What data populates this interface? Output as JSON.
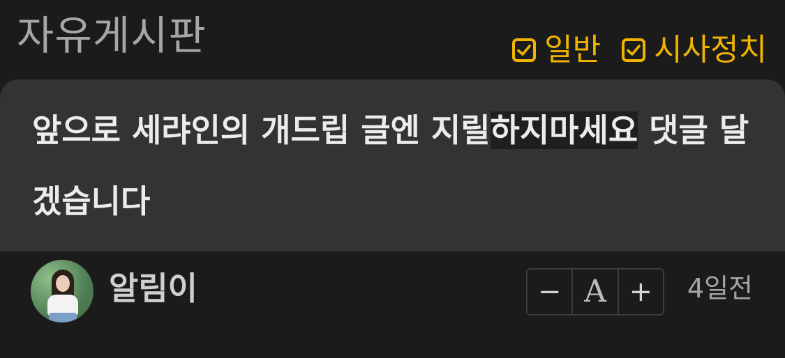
{
  "header": {
    "board_title": "자유게시판",
    "filters": [
      {
        "label": "일반",
        "checked": true
      },
      {
        "label": "시사정치",
        "checked": true
      }
    ]
  },
  "post": {
    "title_part1": "앞으로 세랴인의 개드립 글엔 지릴",
    "title_highlight": "하지마세요",
    "title_part2": " 댓글 달겠습니다"
  },
  "author": {
    "name": "알림이",
    "avatar_icon": "user-photo"
  },
  "font_controls": {
    "decrease": "−",
    "font": "A",
    "increase": "+"
  },
  "timestamp": "4일전",
  "colors": {
    "accent": "#f0b400",
    "background": "#1b1b1b",
    "card": "#333333"
  }
}
